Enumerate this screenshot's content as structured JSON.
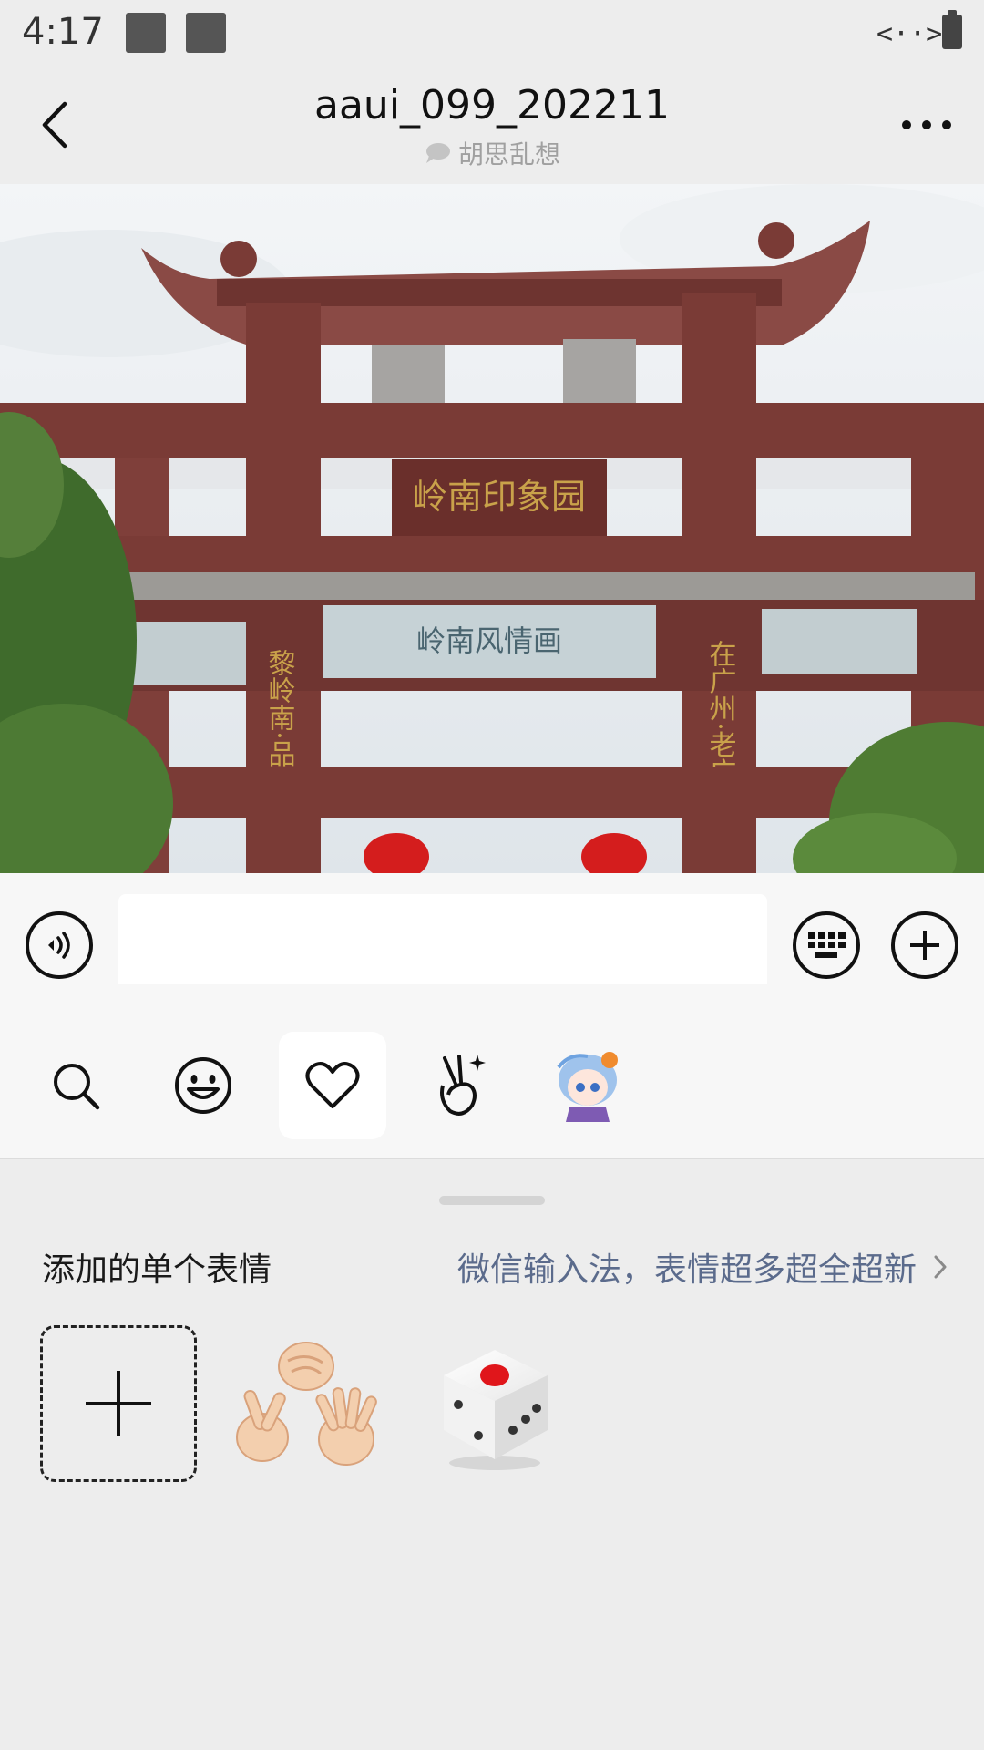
{
  "status_bar": {
    "time": "4:17",
    "network_glyph": "<··>"
  },
  "header": {
    "title": "aaui_099_202211",
    "subtitle": "胡思乱想",
    "back_icon": "chevron-left-icon",
    "more_icon": "more-dots-icon"
  },
  "photo": {
    "description_icon": "photo",
    "sign_text": "岭南印象园",
    "left_couplet": "黎岭南·品岭",
    "right_couplet": "在广州·老广",
    "center_frieze": "岭南风情画"
  },
  "input_bar": {
    "voice_icon": "voice-icon",
    "keyboard_icon": "keyboard-icon",
    "plus_icon": "plus-icon",
    "value": "",
    "placeholder": ""
  },
  "emoji_tabs": [
    {
      "id": "search",
      "icon": "search-icon",
      "active": false
    },
    {
      "id": "smile",
      "icon": "smiley-icon",
      "active": false
    },
    {
      "id": "favorites",
      "icon": "heart-icon",
      "active": true
    },
    {
      "id": "hand",
      "icon": "victory-hand-icon",
      "active": false
    },
    {
      "id": "sticker-pack",
      "icon": "anime-avatar-icon",
      "active": false
    }
  ],
  "panel": {
    "title": "添加的单个表情",
    "promo": "微信输入法，表情超多超全超新",
    "stickers": [
      {
        "id": "add",
        "icon": "add-icon"
      },
      {
        "id": "rps",
        "icon": "rock-paper-scissors-icon"
      },
      {
        "id": "dice",
        "icon": "dice-icon"
      }
    ]
  },
  "colors": {
    "background": "#ededed",
    "bar": "#f7f7f7",
    "promo_text": "#5b6b8c",
    "arch_red": "#7a3b36",
    "lantern_red": "#d41d1d"
  }
}
